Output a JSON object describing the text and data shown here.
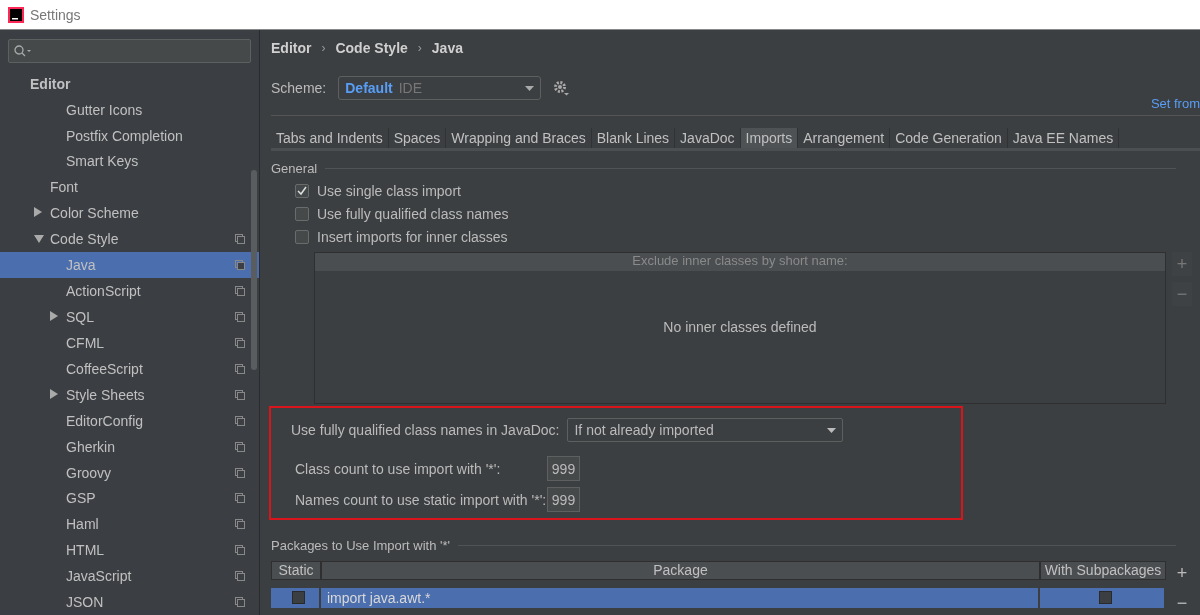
{
  "window": {
    "title": "Settings"
  },
  "sidebar": {
    "items": [
      {
        "label": "Editor",
        "kind": "header",
        "children": [
          {
            "label": "Gutter Icons",
            "kind": "nested",
            "scheme_icon": false,
            "selected": false
          },
          {
            "label": "Postfix Completion",
            "kind": "nested",
            "scheme_icon": false,
            "selected": false
          },
          {
            "label": "Smart Keys",
            "kind": "nested",
            "scheme_icon": false,
            "selected": false
          },
          {
            "label": "Font",
            "kind": "item",
            "scheme_icon": false,
            "selected": false
          },
          {
            "label": "Color Scheme",
            "kind": "item",
            "expanded": false,
            "scheme_icon": false,
            "selected": false
          },
          {
            "label": "Code Style",
            "kind": "item",
            "expanded": true,
            "scheme_icon": true,
            "selected": false,
            "children": [
              {
                "label": "Java",
                "kind": "item",
                "scheme_icon": true,
                "selected": true
              },
              {
                "label": "ActionScript",
                "kind": "item",
                "scheme_icon": true,
                "selected": false
              },
              {
                "label": "SQL",
                "kind": "item",
                "expanded": false,
                "scheme_icon": true,
                "selected": false
              },
              {
                "label": "CFML",
                "kind": "item",
                "scheme_icon": true,
                "selected": false
              },
              {
                "label": "CoffeeScript",
                "kind": "item",
                "scheme_icon": true,
                "selected": false
              },
              {
                "label": "Style Sheets",
                "kind": "item",
                "expanded": false,
                "scheme_icon": true,
                "selected": false
              },
              {
                "label": "EditorConfig",
                "kind": "item",
                "scheme_icon": true,
                "selected": false
              },
              {
                "label": "Gherkin",
                "kind": "item",
                "scheme_icon": true,
                "selected": false
              },
              {
                "label": "Groovy",
                "kind": "item",
                "scheme_icon": true,
                "selected": false
              },
              {
                "label": "GSP",
                "kind": "item",
                "scheme_icon": true,
                "selected": false
              },
              {
                "label": "Haml",
                "kind": "item",
                "scheme_icon": true,
                "selected": false
              },
              {
                "label": "HTML",
                "kind": "item",
                "scheme_icon": true,
                "selected": false
              },
              {
                "label": "JavaScript",
                "kind": "item",
                "scheme_icon": true,
                "selected": false
              },
              {
                "label": "JSON",
                "kind": "item",
                "scheme_icon": true,
                "selected": false
              }
            ]
          }
        ]
      }
    ]
  },
  "breadcrumb": [
    {
      "kind": "crumb",
      "text": "Editor"
    },
    {
      "kind": "separator",
      "text": "›"
    },
    {
      "kind": "crumb",
      "text": "Code Style"
    },
    {
      "kind": "separator",
      "text": "›"
    },
    {
      "kind": "crumb",
      "text": "Java"
    }
  ],
  "scheme": {
    "label": "Scheme:",
    "name": "Default",
    "type": "IDE"
  },
  "set_from": "Set from",
  "tabs": [
    {
      "label": "Tabs and Indents",
      "selected": false
    },
    {
      "label": "Spaces",
      "selected": false
    },
    {
      "label": "Wrapping and Braces",
      "selected": false
    },
    {
      "label": "Blank Lines",
      "selected": false
    },
    {
      "label": "JavaDoc",
      "selected": false
    },
    {
      "label": "Imports",
      "selected": true
    },
    {
      "label": "Arrangement",
      "selected": false
    },
    {
      "label": "Code Generation",
      "selected": false
    },
    {
      "label": "Java EE Names",
      "selected": false
    }
  ],
  "general": {
    "title": "General",
    "options": [
      {
        "label": "Use single class import",
        "checked": true
      },
      {
        "label": "Use fully qualified class names",
        "checked": false
      },
      {
        "label": "Insert imports for inner classes",
        "checked": false
      }
    ],
    "exclude_table": {
      "header": "Exclude inner classes by short name:",
      "empty_text": "No inner classes defined",
      "buttons": [
        "+",
        "−"
      ]
    }
  },
  "highlighted": {
    "javadoc": {
      "label": "Use fully qualified class names in JavaDoc:",
      "value": "If not already imported"
    },
    "fields": [
      {
        "label": "Class count to use import with '*':",
        "value": "999"
      },
      {
        "label": "Names count to use static import with '*':",
        "value": "999"
      }
    ]
  },
  "packages": {
    "title": "Packages to Use Import with '*'",
    "columns": [
      "Static",
      "Package",
      "With Subpackages"
    ],
    "rows": [
      {
        "static": false,
        "package": "import java.awt.*",
        "with_subpackages": false,
        "selected": true
      }
    ],
    "buttons": [
      "+",
      "−"
    ]
  }
}
